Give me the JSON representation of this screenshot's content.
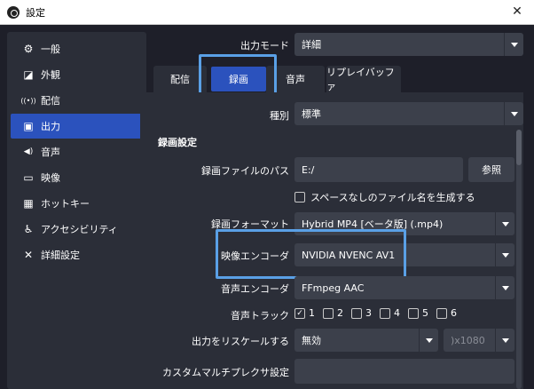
{
  "window": {
    "title": "設定",
    "close_symbol": "✕"
  },
  "sidebar": {
    "items": [
      {
        "label": "一般",
        "icon": "gear-icon",
        "glyph": "⚙"
      },
      {
        "label": "外観",
        "icon": "appearance-icon",
        "glyph": "◪"
      },
      {
        "label": "配信",
        "icon": "broadcast-icon",
        "glyph": "((•))"
      },
      {
        "label": "出力",
        "icon": "output-icon",
        "glyph": "▣"
      },
      {
        "label": "音声",
        "icon": "speaker-icon",
        "glyph": "◀)"
      },
      {
        "label": "映像",
        "icon": "monitor-icon",
        "glyph": "▭"
      },
      {
        "label": "ホットキー",
        "icon": "keyboard-icon",
        "glyph": "▦"
      },
      {
        "label": "アクセシビリティ",
        "icon": "accessibility-icon",
        "glyph": "♿"
      },
      {
        "label": "詳細設定",
        "icon": "tools-icon",
        "glyph": "✕"
      }
    ],
    "active_index": 3
  },
  "output_mode": {
    "label": "出力モード",
    "value": "詳細"
  },
  "tabs": [
    {
      "label": "配信"
    },
    {
      "label": "録画"
    },
    {
      "label": "音声"
    },
    {
      "label": "リプレイバッファ"
    }
  ],
  "active_tab": "録画",
  "type": {
    "label": "種別",
    "value": "標準"
  },
  "recording": {
    "section_title": "録画設定",
    "path_label": "録画ファイルのパス",
    "path_value": "E:/",
    "browse_label": "参照",
    "nospace_label": "スペースなしのファイル名を生成する",
    "format_label": "録画フォーマット",
    "format_value": "Hybrid MP4 [ベータ版] (.mp4)",
    "video_encoder_label": "映像エンコーダ",
    "video_encoder_value": "NVIDIA NVENC AV1",
    "audio_encoder_label": "音声エンコーダ",
    "audio_encoder_value": "FFmpeg AAC",
    "audio_track_label": "音声トラック",
    "tracks": [
      {
        "n": "1",
        "checked": true
      },
      {
        "n": "2",
        "checked": false
      },
      {
        "n": "3",
        "checked": false
      },
      {
        "n": "4",
        "checked": false
      },
      {
        "n": "5",
        "checked": false
      },
      {
        "n": "6",
        "checked": false
      }
    ],
    "rescale_label": "出力をリスケールする",
    "rescale_value": "無効",
    "rescale_resolution": ")x1080",
    "muxer_label": "カスタムマルチプレクサ設定",
    "muxer_value": ""
  },
  "colors": {
    "accent": "#2b52bd",
    "highlight": "#5aa0e6",
    "bg": "#1e1f29",
    "panel": "#2b2e38",
    "field": "#3c404b"
  }
}
